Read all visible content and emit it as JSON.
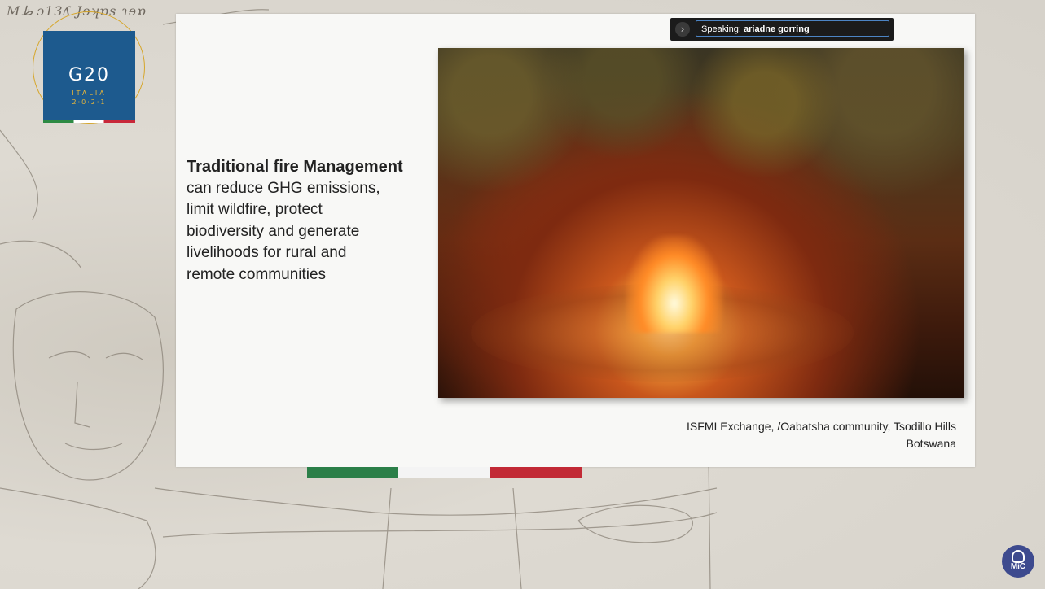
{
  "background": {
    "scribble_text": "Mظ‎ ɔ13ʎ Jɘʞɒs ɿɘɒ"
  },
  "logo": {
    "main": "G20",
    "line1": "ITALIA",
    "line2": "2·0·2·1"
  },
  "speaker_bar": {
    "prefix": "Speaking:",
    "name": "ariadne gorring",
    "chevron": "›"
  },
  "slide": {
    "heading": "Traditional fire Management",
    "body_lines": [
      "can reduce GHG emissions,",
      "limit wildfire, protect",
      "biodiversity and generate",
      "livelihoods for rural and",
      "remote communities"
    ],
    "photo_alt": "Campfire with community members",
    "caption_line1": "ISFMI Exchange, /Oabatsha community, Tsodillo Hills",
    "caption_line2": "Botswana"
  },
  "mic_badge": {
    "label": "MiC"
  },
  "colors": {
    "logo_blue": "#1d5a8e",
    "gold": "#d6a62b",
    "flag_green": "#2b7f48",
    "flag_red": "#c22a35",
    "speaker_border": "#4c84c4"
  }
}
